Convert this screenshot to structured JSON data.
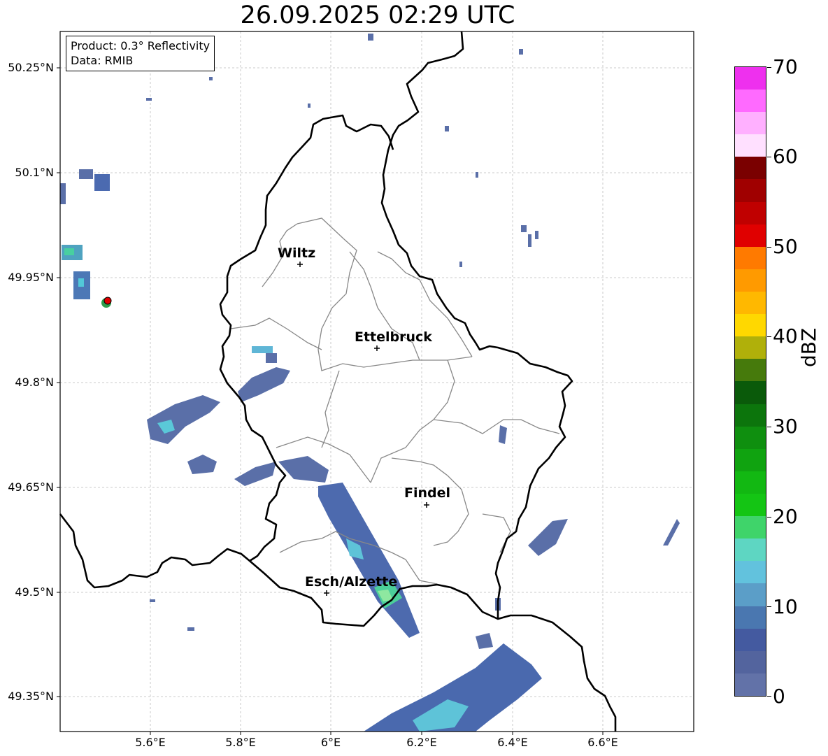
{
  "title": "26.09.2025 02:29 UTC",
  "info": {
    "product": "Product: 0.3° Reflectivity",
    "data_source": "Data: RMIB"
  },
  "lat_ticks": [
    "50.25°N",
    "50.1°N",
    "49.95°N",
    "49.8°N",
    "49.65°N",
    "49.5°N",
    "49.35°N"
  ],
  "lon_ticks": [
    "5.6°E",
    "5.8°E",
    "6°E",
    "6.2°E",
    "6.4°E",
    "6.6°E"
  ],
  "cities": [
    {
      "name": "Wiltz"
    },
    {
      "name": "Ettelbruck"
    },
    {
      "name": "Findel"
    },
    {
      "name": "Esch/Alzette"
    }
  ],
  "colorbar": {
    "unit": "dBZ",
    "min": 0,
    "max": 70,
    "tick_labels": [
      "0",
      "10",
      "20",
      "30",
      "40",
      "50",
      "60",
      "70"
    ],
    "colors": [
      "#6272a8",
      "#53649e",
      "#445aa0",
      "#4a77b0",
      "#5b9ec8",
      "#62c2dd",
      "#5ed6c2",
      "#3fd46a",
      "#14c514",
      "#12b812",
      "#10a310",
      "#0f8f0f",
      "#0c750c",
      "#0a5a0a",
      "#467a0c",
      "#b0b00a",
      "#ffd800",
      "#ffb800",
      "#ff9a00",
      "#ff7a00",
      "#e00000",
      "#c00000",
      "#a00000",
      "#7a0000",
      "#ffe0ff",
      "#ffb0ff",
      "#ff6aff",
      "#ee30ee"
    ]
  }
}
